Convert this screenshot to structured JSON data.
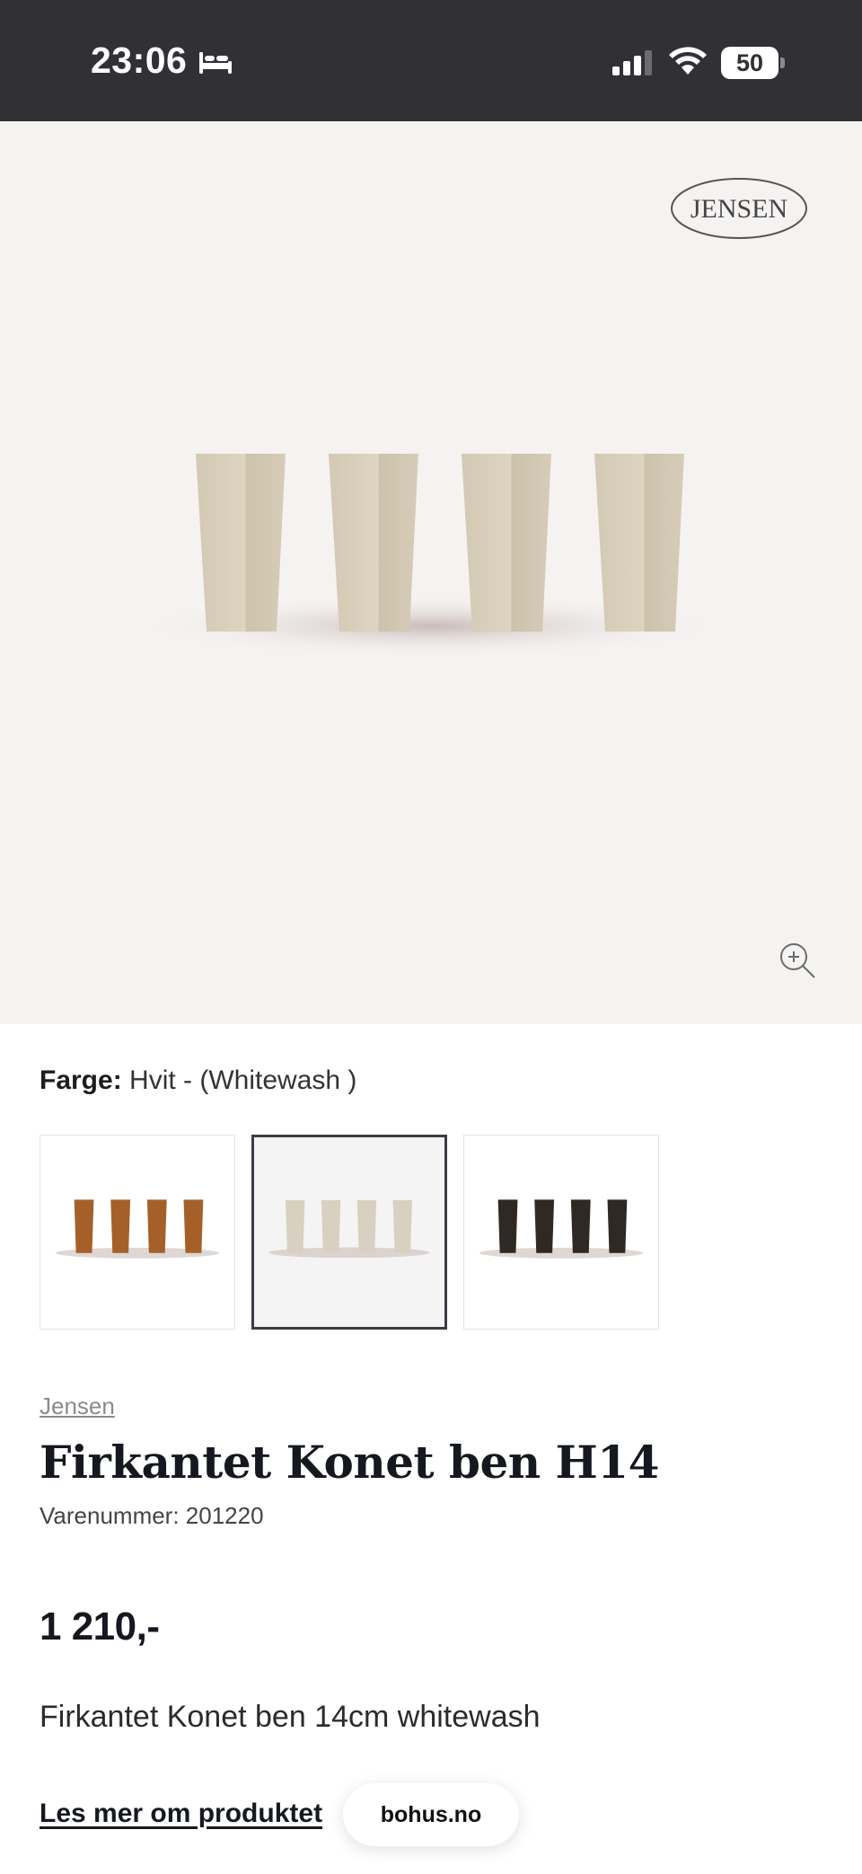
{
  "status_bar": {
    "time": "23:06",
    "battery_level": "50",
    "icons": [
      "sleep-bed-icon",
      "cellular-signal-icon",
      "wifi-icon",
      "battery-icon"
    ]
  },
  "hero": {
    "brand_logo_text": "JENSEN",
    "zoom_icon": "zoom-in-icon"
  },
  "variant": {
    "label": "Farge:",
    "value": "Hvit - (Whitewash )",
    "swatches": [
      {
        "name": "teak",
        "color": "#a5602a",
        "selected": false
      },
      {
        "name": "whitewash",
        "color": "#d8d0c0",
        "selected": true
      },
      {
        "name": "dark",
        "color": "#2f2925",
        "selected": false
      }
    ]
  },
  "product": {
    "brand": "Jensen",
    "title": "Firkantet Konet ben H14",
    "sku_line": "Varenummer: 201220",
    "price": "1 210,-",
    "short_description": "Firkantet Konet ben 14cm whitewash",
    "read_more": "Les mer om produktet"
  },
  "browser": {
    "domain": "bohus.no"
  },
  "colors": {
    "status_bar_bg": "#303035",
    "hero_bg": "#f5f3f2",
    "text_dark": "#15181f",
    "selected_border": "#3a3d45"
  }
}
